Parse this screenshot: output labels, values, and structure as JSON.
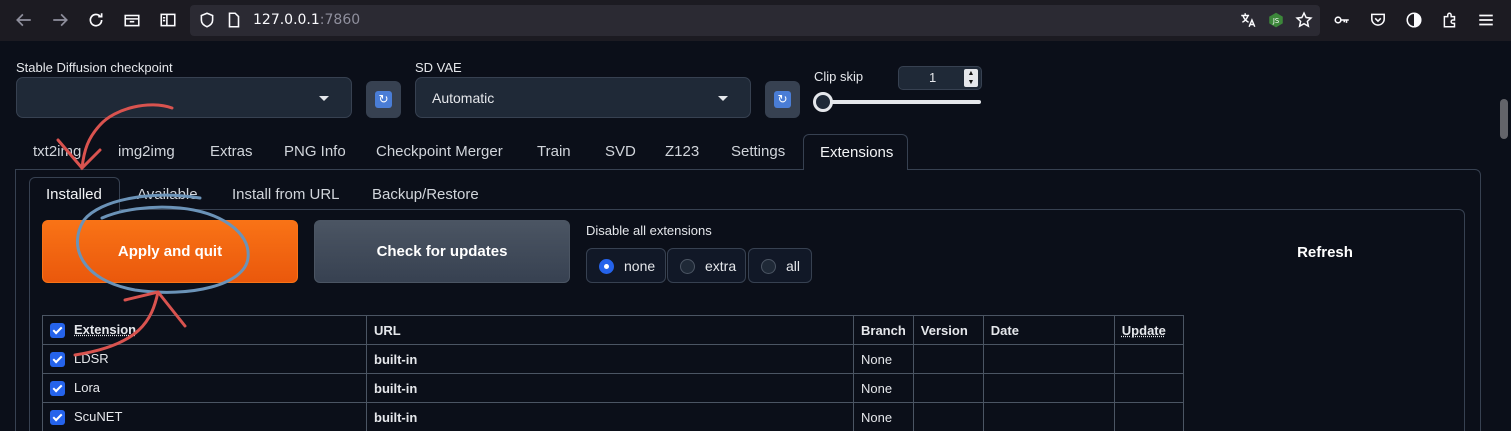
{
  "browser": {
    "url_host": "127.0.0.1",
    "url_port": ":7860"
  },
  "top": {
    "checkpoint_label": "Stable Diffusion checkpoint",
    "checkpoint_value": "",
    "vae_label": "SD VAE",
    "vae_value": "Automatic",
    "clip_skip_label": "Clip skip",
    "clip_skip_value": "1"
  },
  "tabs": [
    "txt2img",
    "img2img",
    "Extras",
    "PNG Info",
    "Checkpoint Merger",
    "Train",
    "SVD",
    "Z123",
    "Settings",
    "Extensions"
  ],
  "active_tab": "Extensions",
  "subtabs": [
    "Installed",
    "Available",
    "Install from URL",
    "Backup/Restore"
  ],
  "active_subtab": "Installed",
  "actions": {
    "apply_label": "Apply and quit",
    "check_label": "Check for updates",
    "refresh_label": "Refresh"
  },
  "disable": {
    "label": "Disable all extensions",
    "options": [
      "none",
      "extra",
      "all"
    ],
    "selected": "none"
  },
  "table": {
    "headers": [
      "Extension",
      "URL",
      "Branch",
      "Version",
      "Date",
      "Update"
    ],
    "rows": [
      {
        "name": "LDSR",
        "url": "built-in",
        "branch": "None",
        "version": "",
        "date": "",
        "update": ""
      },
      {
        "name": "Lora",
        "url": "built-in",
        "branch": "None",
        "version": "",
        "date": "",
        "update": ""
      },
      {
        "name": "ScuNET",
        "url": "built-in",
        "branch": "None",
        "version": "",
        "date": "",
        "update": ""
      }
    ]
  },
  "colors": {
    "accent": "#f97316",
    "annotation_red": "#d9534f",
    "annotation_blue": "#6b93b8"
  }
}
